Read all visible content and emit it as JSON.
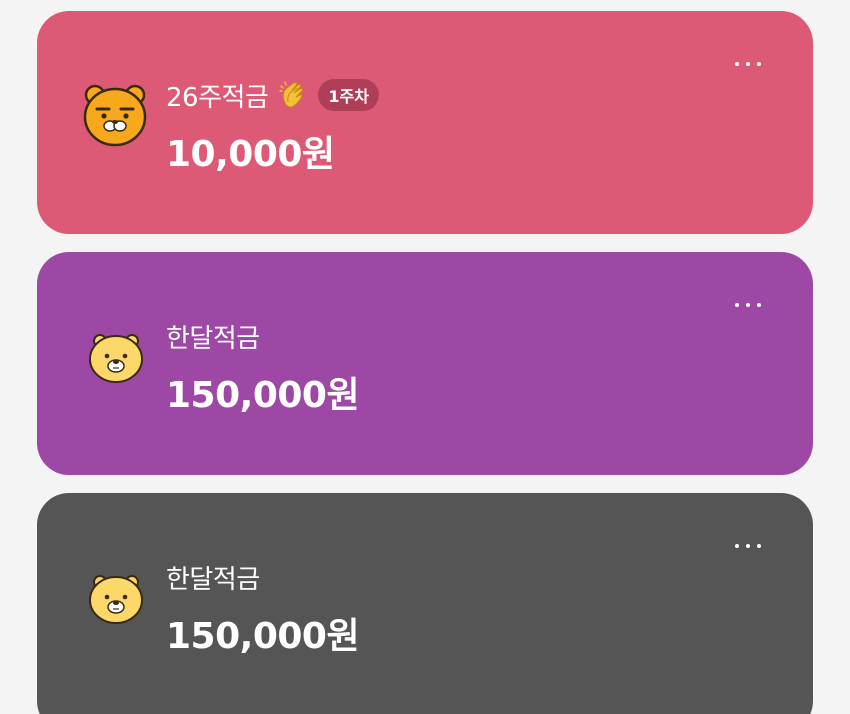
{
  "cards": [
    {
      "title": "26주적금",
      "badge": "1주차",
      "amount": "10,000원",
      "color": "#dc5a75",
      "icon": "ryan-character-icon",
      "emoji": "clapping-hands-icon"
    },
    {
      "title": "한달적금",
      "amount": "150,000원",
      "color": "#9e48a6",
      "icon": "choonsik-character-icon"
    },
    {
      "title": "한달적금",
      "amount": "150,000원",
      "color": "#555555",
      "icon": "choonsik-character-icon"
    }
  ],
  "colors": {
    "background": "#f4f4f4",
    "avatar_yellow": "#fcd86a",
    "ryan_orange": "#f7a81c"
  }
}
